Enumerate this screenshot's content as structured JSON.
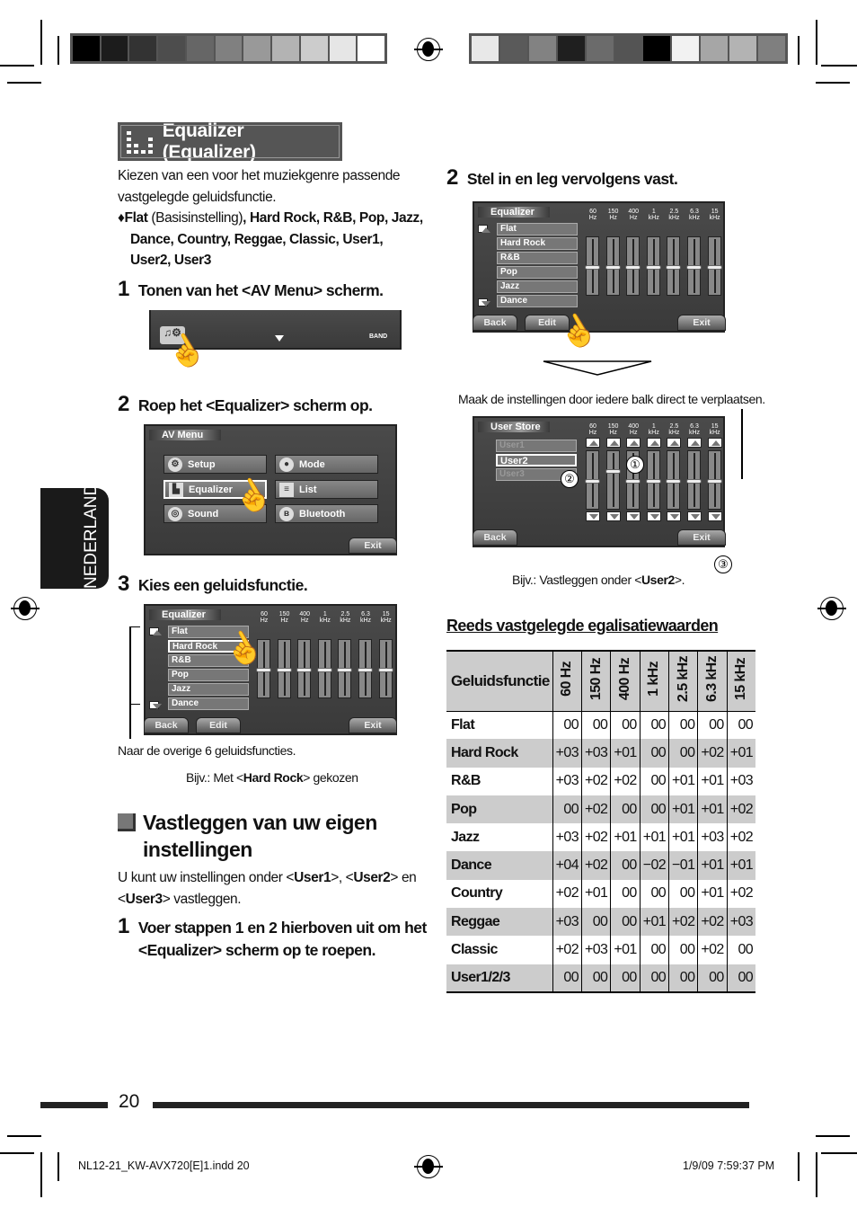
{
  "color_bars": {
    "left": [
      "#000000",
      "#1c1c1c",
      "#333333",
      "#4d4d4d",
      "#666666",
      "#808080",
      "#999999",
      "#b3b3b3",
      "#cccccc",
      "#e6e6e6",
      "#ffffff"
    ],
    "right": [
      "#e8e8e8",
      "#5a5a5a",
      "#828282",
      "#1f1f1f",
      "#6b6b6b",
      "#545454",
      "#000000",
      "#f2f2f2",
      "#a6a6a6",
      "#b3b3b3",
      "#7f7f7f"
    ]
  },
  "section_title": "Equalizer (Equalizer)",
  "intro": "Kiezen van een voor het muziekgenre passende vastgelegde geluidsfunctie.",
  "presets_line": {
    "bullet": "♦",
    "first": "Flat",
    "first_note": " (Basisinstelling)",
    "rest": ", Hard Rock, R&B, Pop, Jazz, Dance, Country, Reggae, Classic, User1, User2, User3"
  },
  "steps_left": [
    {
      "num": "1",
      "text": "Tonen van het <AV Menu> scherm."
    },
    {
      "num": "2",
      "text": "Roep het <Equalizer> scherm op."
    },
    {
      "num": "3",
      "text": "Kies een geluidsfunctie."
    }
  ],
  "screen1": {
    "band": "BAND"
  },
  "av_menu": {
    "title": "AV Menu",
    "items": [
      "Setup",
      "Mode",
      "Equalizer",
      "List",
      "Sound",
      "Bluetooth"
    ],
    "exit": "Exit"
  },
  "eq_screen": {
    "title": "Equalizer",
    "freqs": [
      [
        "60",
        "Hz"
      ],
      [
        "150",
        "Hz"
      ],
      [
        "400",
        "Hz"
      ],
      [
        "1",
        "kHz"
      ],
      [
        "2.5",
        "kHz"
      ],
      [
        "6.3",
        "kHz"
      ],
      [
        "15",
        "kHz"
      ]
    ],
    "list": [
      "Flat",
      "Hard Rock",
      "R&B",
      "Pop",
      "Jazz",
      "Dance"
    ],
    "back": "Back",
    "edit": "Edit",
    "exit": "Exit"
  },
  "caption_other": "Naar de overige 6 geluidsfuncties.",
  "caption_example": {
    "pre": "Bijv.: Met <",
    "bold": "Hard Rock",
    "post": "> gekozen"
  },
  "own_heading": "Vastleggen van uw eigen instellingen",
  "own_para": {
    "a": "U kunt uw instellingen onder <",
    "u1": "User1",
    "b": ">, <",
    "u2": "User2",
    "c": "> en <",
    "u3": "User3",
    "d": "> vastleggen."
  },
  "own_step": {
    "num": "1",
    "text": "Voer stappen 1 en 2 hierboven uit om het <Equalizer> scherm op te roepen."
  },
  "step_right": {
    "num": "2",
    "text": "Stel in en leg vervolgens vast."
  },
  "caption_move": "Maak de instellingen door iedere balk direct te verplaatsen.",
  "user_store": {
    "title": "User Store",
    "items": [
      "User1",
      "User2",
      "User3"
    ],
    "back": "Back",
    "exit": "Exit",
    "callouts": [
      "①",
      "②",
      "③"
    ]
  },
  "caption_store": {
    "pre": "Bijv.: Vastleggen onder <",
    "bold": "User2",
    "post": ">."
  },
  "table_heading": "Reeds vastgelegde egalisatiewaarden",
  "table": {
    "headers": [
      "Geluidsfunctie",
      "60 Hz",
      "150 Hz",
      "400 Hz",
      "1 kHz",
      "2.5 kHz",
      "6.3 kHz",
      "15 kHz"
    ],
    "rows": [
      [
        "Flat",
        "00",
        "00",
        "00",
        "00",
        "00",
        "00",
        "00"
      ],
      [
        "Hard Rock",
        "+03",
        "+03",
        "+01",
        "00",
        "00",
        "+02",
        "+01"
      ],
      [
        "R&B",
        "+03",
        "+02",
        "+02",
        "00",
        "+01",
        "+01",
        "+03"
      ],
      [
        "Pop",
        "00",
        "+02",
        "00",
        "00",
        "+01",
        "+01",
        "+02"
      ],
      [
        "Jazz",
        "+03",
        "+02",
        "+01",
        "+01",
        "+01",
        "+03",
        "+02"
      ],
      [
        "Dance",
        "+04",
        "+02",
        "00",
        "−02",
        "−01",
        "+01",
        "+01"
      ],
      [
        "Country",
        "+02",
        "+01",
        "00",
        "00",
        "00",
        "+01",
        "+02"
      ],
      [
        "Reggae",
        "+03",
        "00",
        "00",
        "+01",
        "+02",
        "+02",
        "+03"
      ],
      [
        "Classic",
        "+02",
        "+03",
        "+01",
        "00",
        "00",
        "+02",
        "00"
      ],
      [
        "User1/2/3",
        "00",
        "00",
        "00",
        "00",
        "00",
        "00",
        "00"
      ]
    ]
  },
  "side_tab": "NEDERLANDS",
  "page_number": "20",
  "footer": {
    "file": "NL12-21_KW-AVX720[E]1.indd   20",
    "date": "1/9/09   7:59:37 PM"
  }
}
